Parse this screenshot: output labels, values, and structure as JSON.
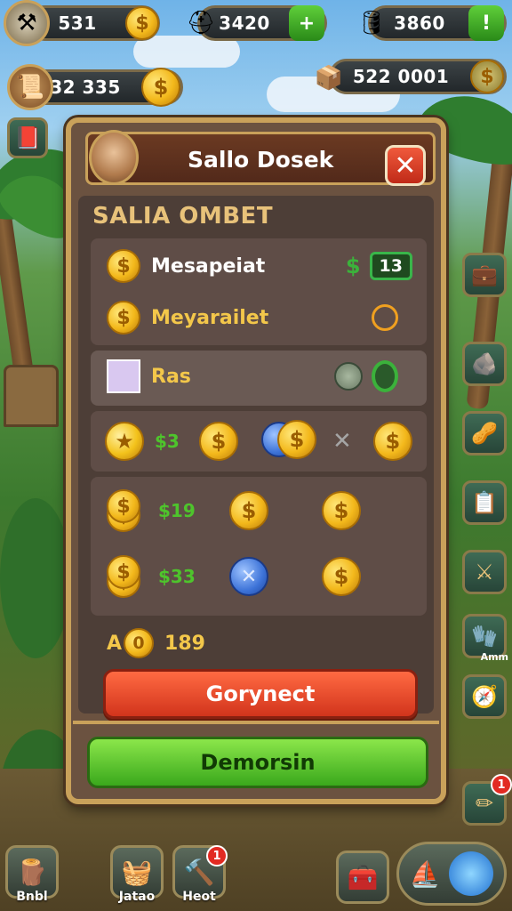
{
  "resources": {
    "r1": {
      "value": "531"
    },
    "r2": {
      "value": "3420"
    },
    "r3": {
      "value": "3860"
    },
    "r4": {
      "value": "32 335"
    },
    "r5": {
      "value": "522 0001"
    }
  },
  "dialog": {
    "title": "Sallo Dosek",
    "subtitle": "SALIA OMBET",
    "rows": {
      "mesapeiat": {
        "label": "Mesapeiat",
        "badge": "13"
      },
      "meyarailet": {
        "label": "Meyarailet"
      },
      "ras": {
        "label": "Ras"
      }
    },
    "coin_row": {
      "value": "$3"
    },
    "stack_rows": [
      {
        "value": "$19"
      },
      {
        "value": "$33"
      }
    ],
    "total": {
      "prefix": "A",
      "value": "189"
    },
    "primary_button": "Gorynect",
    "confirm_button": "Demorsin"
  },
  "side_menu": {
    "label": "Amm",
    "notify_count": "1"
  },
  "dock": {
    "items": [
      {
        "label": "Bnbl"
      },
      {
        "label": "Jatao"
      },
      {
        "label": "Heot",
        "badge": "1"
      }
    ]
  },
  "icons": {
    "coin_symbol": "$",
    "close_symbol": "✕",
    "x_symbol": "✕"
  }
}
